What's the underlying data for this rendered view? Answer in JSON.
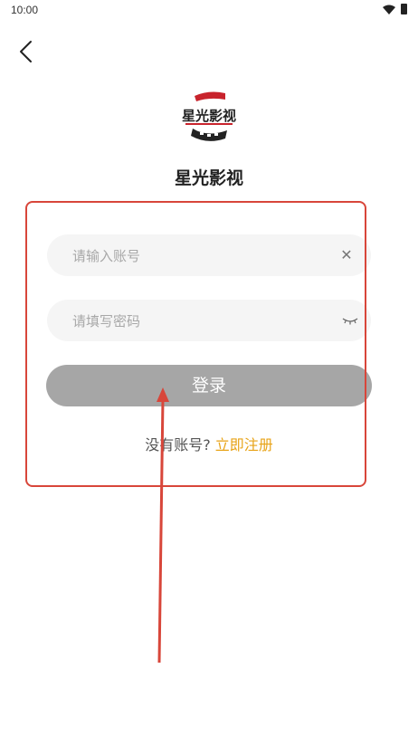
{
  "status_bar": {
    "time": "10:00",
    "wifi_icon": "wifi-icon",
    "battery_icon": "battery-icon"
  },
  "header": {
    "back_icon": "chevron-left-icon"
  },
  "logo": {
    "icon": "film-logo-icon",
    "text": "星光影视"
  },
  "app_name": "星光影视",
  "form": {
    "account": {
      "value": "",
      "placeholder": "请输入账号",
      "clear_icon": "close-icon"
    },
    "password": {
      "value": "",
      "placeholder": "请填写密码",
      "toggle_icon": "eye-closed-icon"
    },
    "login_label": "登录"
  },
  "register": {
    "prompt": "没有账号?",
    "link": "立即注册"
  },
  "colors": {
    "accent": "#e8a317",
    "annotation": "#d8463a",
    "button_disabled": "#a6a6a6",
    "input_bg": "#f5f5f5",
    "logo_red": "#c8232c"
  }
}
